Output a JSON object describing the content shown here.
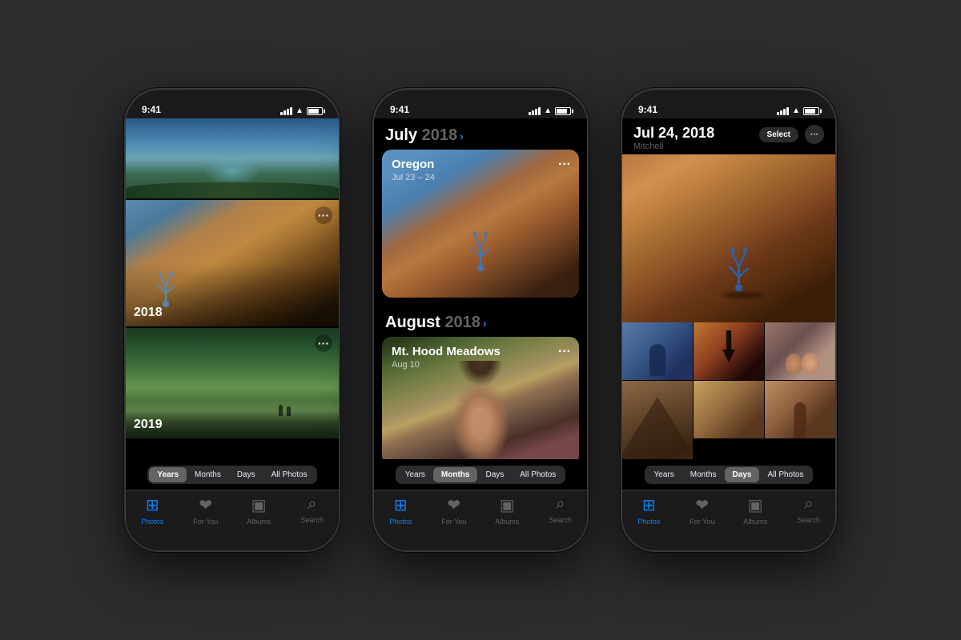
{
  "background": "#2c2c2e",
  "phones": [
    {
      "id": "years",
      "status": {
        "time": "9:41",
        "signal": true,
        "wifi": true,
        "battery": true
      },
      "view": "years",
      "photos": [
        {
          "label": "",
          "type": "hero"
        },
        {
          "label": "2018",
          "type": "year"
        },
        {
          "label": "2019",
          "type": "year"
        }
      ],
      "segments": [
        "Years",
        "Months",
        "Days",
        "All Photos"
      ],
      "active_segment": "Years",
      "tabs": [
        {
          "label": "Photos",
          "active": true
        },
        {
          "label": "For You",
          "active": false
        },
        {
          "label": "Albums",
          "active": false
        },
        {
          "label": "Search",
          "active": false
        }
      ]
    },
    {
      "id": "months",
      "status": {
        "time": "9:41"
      },
      "view": "months",
      "months": [
        {
          "title": "July",
          "year": "2018",
          "memories": [
            {
              "title": "Oregon",
              "date": "Jul 23 – 24",
              "type": "handstand"
            }
          ]
        },
        {
          "title": "August",
          "year": "2018",
          "memories": [
            {
              "title": "Mt. Hood Meadows",
              "date": "Aug 10",
              "type": "portrait"
            }
          ]
        }
      ],
      "segments": [
        "Years",
        "Months",
        "Days",
        "All Photos"
      ],
      "active_segment": "Months",
      "tabs": [
        {
          "label": "Photos",
          "active": true
        },
        {
          "label": "For You",
          "active": false
        },
        {
          "label": "Albums",
          "active": false
        },
        {
          "label": "Search",
          "active": false
        }
      ]
    },
    {
      "id": "days",
      "status": {
        "time": "9:41"
      },
      "view": "days",
      "day_header": {
        "date": "Jul 24, 2018",
        "location": "Mitchell",
        "select_label": "Select"
      },
      "segments": [
        "Years",
        "Months",
        "Days",
        "All Photos"
      ],
      "active_segment": "Days",
      "tabs": [
        {
          "label": "Photos",
          "active": true
        },
        {
          "label": "For You",
          "active": false
        },
        {
          "label": "Albums",
          "active": false
        },
        {
          "label": "Search",
          "active": false
        }
      ]
    }
  ]
}
